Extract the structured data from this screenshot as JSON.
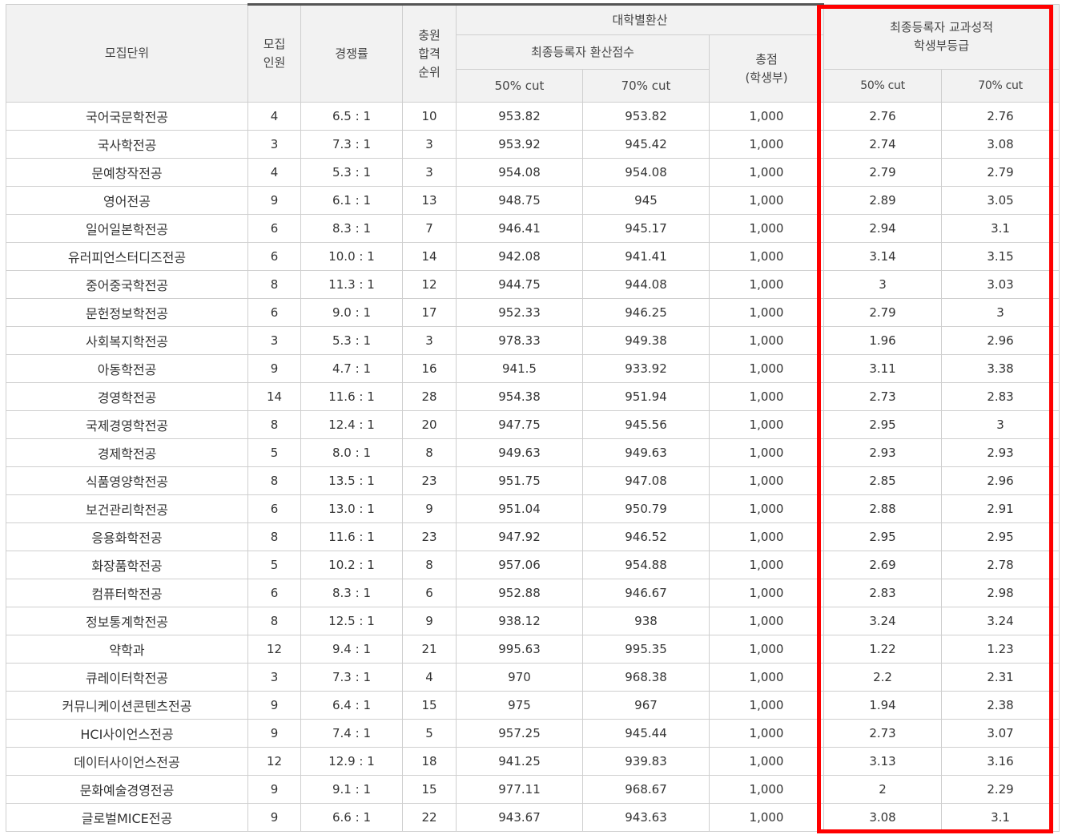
{
  "header": {
    "unit": "모집단위",
    "quota": "모집\n인원",
    "competition": "경쟁률",
    "waitlist": "충원\n합격\n순위",
    "univ_conv": "대학별환산",
    "final_conv": "최종등록자 환산점수",
    "total": "총점\n(학생부)",
    "grade": "최종등록자 교과성적\n학생부등급",
    "cut50": "50% cut",
    "cut70": "70% cut",
    "cut50b": "50% cut",
    "cut70b": "70% cut"
  },
  "rows": [
    {
      "unit": "국어국문학전공",
      "quota": "4",
      "comp": "6.5 : 1",
      "rank": "10",
      "s50": "953.82",
      "s70": "953.82",
      "total": "1,000",
      "g50": "2.76",
      "g70": "2.76"
    },
    {
      "unit": "국사학전공",
      "quota": "3",
      "comp": "7.3 : 1",
      "rank": "3",
      "s50": "953.92",
      "s70": "945.42",
      "total": "1,000",
      "g50": "2.74",
      "g70": "3.08"
    },
    {
      "unit": "문예창작전공",
      "quota": "4",
      "comp": "5.3 : 1",
      "rank": "3",
      "s50": "954.08",
      "s70": "954.08",
      "total": "1,000",
      "g50": "2.79",
      "g70": "2.79"
    },
    {
      "unit": "영어전공",
      "quota": "9",
      "comp": "6.1 : 1",
      "rank": "13",
      "s50": "948.75",
      "s70": "945",
      "total": "1,000",
      "g50": "2.89",
      "g70": "3.05"
    },
    {
      "unit": "일어일본학전공",
      "quota": "6",
      "comp": "8.3 : 1",
      "rank": "7",
      "s50": "946.41",
      "s70": "945.17",
      "total": "1,000",
      "g50": "2.94",
      "g70": "3.1"
    },
    {
      "unit": "유러피언스터디즈전공",
      "quota": "6",
      "comp": "10.0 : 1",
      "rank": "14",
      "s50": "942.08",
      "s70": "941.41",
      "total": "1,000",
      "g50": "3.14",
      "g70": "3.15"
    },
    {
      "unit": "중어중국학전공",
      "quota": "8",
      "comp": "11.3 : 1",
      "rank": "12",
      "s50": "944.75",
      "s70": "944.08",
      "total": "1,000",
      "g50": "3",
      "g70": "3.03"
    },
    {
      "unit": "문헌정보학전공",
      "quota": "6",
      "comp": "9.0 : 1",
      "rank": "17",
      "s50": "952.33",
      "s70": "946.25",
      "total": "1,000",
      "g50": "2.79",
      "g70": "3"
    },
    {
      "unit": "사회복지학전공",
      "quota": "3",
      "comp": "5.3 : 1",
      "rank": "3",
      "s50": "978.33",
      "s70": "949.38",
      "total": "1,000",
      "g50": "1.96",
      "g70": "2.96"
    },
    {
      "unit": "아동학전공",
      "quota": "9",
      "comp": "4.7 : 1",
      "rank": "16",
      "s50": "941.5",
      "s70": "933.92",
      "total": "1,000",
      "g50": "3.11",
      "g70": "3.38"
    },
    {
      "unit": "경영학전공",
      "quota": "14",
      "comp": "11.6 : 1",
      "rank": "28",
      "s50": "954.38",
      "s70": "951.94",
      "total": "1,000",
      "g50": "2.73",
      "g70": "2.83"
    },
    {
      "unit": "국제경영학전공",
      "quota": "8",
      "comp": "12.4 : 1",
      "rank": "20",
      "s50": "947.75",
      "s70": "945.56",
      "total": "1,000",
      "g50": "2.95",
      "g70": "3"
    },
    {
      "unit": "경제학전공",
      "quota": "5",
      "comp": "8.0 : 1",
      "rank": "8",
      "s50": "949.63",
      "s70": "949.63",
      "total": "1,000",
      "g50": "2.93",
      "g70": "2.93"
    },
    {
      "unit": "식품영양학전공",
      "quota": "8",
      "comp": "13.5 : 1",
      "rank": "23",
      "s50": "951.75",
      "s70": "947.08",
      "total": "1,000",
      "g50": "2.85",
      "g70": "2.96"
    },
    {
      "unit": "보건관리학전공",
      "quota": "6",
      "comp": "13.0 : 1",
      "rank": "9",
      "s50": "951.04",
      "s70": "950.79",
      "total": "1,000",
      "g50": "2.88",
      "g70": "2.91"
    },
    {
      "unit": "응용화학전공",
      "quota": "8",
      "comp": "11.6 : 1",
      "rank": "23",
      "s50": "947.92",
      "s70": "946.52",
      "total": "1,000",
      "g50": "2.95",
      "g70": "2.95"
    },
    {
      "unit": "화장품학전공",
      "quota": "5",
      "comp": "10.2 : 1",
      "rank": "8",
      "s50": "957.06",
      "s70": "954.88",
      "total": "1,000",
      "g50": "2.69",
      "g70": "2.78"
    },
    {
      "unit": "컴퓨터학전공",
      "quota": "6",
      "comp": "8.3 : 1",
      "rank": "6",
      "s50": "952.88",
      "s70": "946.67",
      "total": "1,000",
      "g50": "2.83",
      "g70": "2.98"
    },
    {
      "unit": "정보통계학전공",
      "quota": "8",
      "comp": "12.5 : 1",
      "rank": "9",
      "s50": "938.12",
      "s70": "938",
      "total": "1,000",
      "g50": "3.24",
      "g70": "3.24"
    },
    {
      "unit": "약학과",
      "quota": "12",
      "comp": "9.4 : 1",
      "rank": "21",
      "s50": "995.63",
      "s70": "995.35",
      "total": "1,000",
      "g50": "1.22",
      "g70": "1.23"
    },
    {
      "unit": "큐레이터학전공",
      "quota": "3",
      "comp": "7.3 : 1",
      "rank": "4",
      "s50": "970",
      "s70": "968.38",
      "total": "1,000",
      "g50": "2.2",
      "g70": "2.31"
    },
    {
      "unit": "커뮤니케이션콘텐츠전공",
      "quota": "9",
      "comp": "6.4 : 1",
      "rank": "15",
      "s50": "975",
      "s70": "967",
      "total": "1,000",
      "g50": "1.94",
      "g70": "2.38"
    },
    {
      "unit": "HCI사이언스전공",
      "quota": "9",
      "comp": "7.4 : 1",
      "rank": "5",
      "s50": "957.25",
      "s70": "945.44",
      "total": "1,000",
      "g50": "2.73",
      "g70": "3.07"
    },
    {
      "unit": "데이터사이언스전공",
      "quota": "12",
      "comp": "12.9 : 1",
      "rank": "18",
      "s50": "941.25",
      "s70": "939.83",
      "total": "1,000",
      "g50": "3.13",
      "g70": "3.16"
    },
    {
      "unit": "문화예술경영전공",
      "quota": "9",
      "comp": "9.1 : 1",
      "rank": "15",
      "s50": "977.11",
      "s70": "968.67",
      "total": "1,000",
      "g50": "2",
      "g70": "2.29"
    },
    {
      "unit": "글로벌MICE전공",
      "quota": "9",
      "comp": "6.6 : 1",
      "rank": "22",
      "s50": "943.67",
      "s70": "943.63",
      "total": "1,000",
      "g50": "3.08",
      "g70": "3.1"
    }
  ],
  "colors": {
    "highlight": "#ff0000",
    "header_bg": "#f2f2f2",
    "border": "#cfcfcf"
  }
}
